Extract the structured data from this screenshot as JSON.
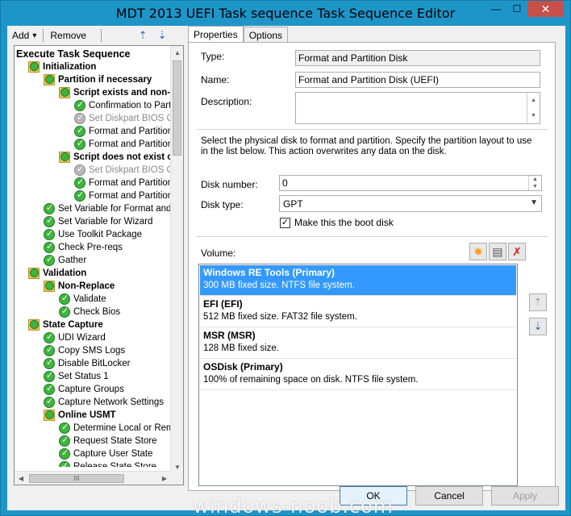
{
  "window": {
    "title": "MDT 2013 UEFI Task sequence Task Sequence Editor",
    "minimize": "—",
    "maximize": "☐",
    "close": "✕"
  },
  "toolbar": {
    "add_label": "Add",
    "add_arrow": "▾",
    "remove_label": "Remove",
    "move_up_icon": "⇡",
    "move_down_icon": "⇣"
  },
  "tree": {
    "nodes": [
      {
        "label": "Execute Task Sequence",
        "indent": 0,
        "icon": "none",
        "style": "group"
      },
      {
        "label": "Initialization",
        "indent": 1,
        "icon": "folder",
        "style": "bold"
      },
      {
        "label": "Partition if necessary",
        "indent": 2,
        "icon": "folder",
        "style": "bold"
      },
      {
        "label": "Script exists and non-N",
        "indent": 3,
        "icon": "folder",
        "style": "bold"
      },
      {
        "label": "Confirmation to Partition",
        "indent": 4,
        "icon": "check",
        "style": "normal"
      },
      {
        "label": "Set Diskpart BIOS Com",
        "indent": 4,
        "icon": "gcheck",
        "style": "grey"
      },
      {
        "label": "Format and Partition Dis",
        "indent": 4,
        "icon": "check",
        "style": "normal"
      },
      {
        "label": "Format and Partition Dis",
        "indent": 4,
        "icon": "check",
        "style": "normal"
      },
      {
        "label": "Script does not exist or",
        "indent": 3,
        "icon": "folder",
        "style": "bold"
      },
      {
        "label": "Set Diskpart BIOS Com",
        "indent": 4,
        "icon": "gcheck",
        "style": "grey"
      },
      {
        "label": "Format and Partition Dis",
        "indent": 4,
        "icon": "check",
        "style": "normal"
      },
      {
        "label": "Format and Partition Dis",
        "indent": 4,
        "icon": "check",
        "style": "normal"
      },
      {
        "label": "Set Variable for Format and Par",
        "indent": 2,
        "icon": "check",
        "style": "normal"
      },
      {
        "label": "Set Variable for Wizard",
        "indent": 2,
        "icon": "check",
        "style": "normal"
      },
      {
        "label": "Use Toolkit Package",
        "indent": 2,
        "icon": "check",
        "style": "normal"
      },
      {
        "label": "Check Pre-reqs",
        "indent": 2,
        "icon": "check",
        "style": "normal"
      },
      {
        "label": "Gather",
        "indent": 2,
        "icon": "check",
        "style": "normal"
      },
      {
        "label": "Validation",
        "indent": 1,
        "icon": "folder",
        "style": "bold"
      },
      {
        "label": "Non-Replace",
        "indent": 2,
        "icon": "folder",
        "style": "bold"
      },
      {
        "label": "Validate",
        "indent": 3,
        "icon": "check",
        "style": "normal"
      },
      {
        "label": "Check Bios",
        "indent": 3,
        "icon": "check",
        "style": "normal"
      },
      {
        "label": "State Capture",
        "indent": 1,
        "icon": "folder",
        "style": "bold"
      },
      {
        "label": "UDI Wizard",
        "indent": 2,
        "icon": "check",
        "style": "normal"
      },
      {
        "label": "Copy SMS Logs",
        "indent": 2,
        "icon": "check",
        "style": "normal"
      },
      {
        "label": "Disable BitLocker",
        "indent": 2,
        "icon": "check",
        "style": "normal"
      },
      {
        "label": "Set Status 1",
        "indent": 2,
        "icon": "check",
        "style": "normal"
      },
      {
        "label": "Capture Groups",
        "indent": 2,
        "icon": "check",
        "style": "normal"
      },
      {
        "label": "Capture Network Settings",
        "indent": 2,
        "icon": "check",
        "style": "normal"
      },
      {
        "label": "Online USMT",
        "indent": 2,
        "icon": "folder",
        "style": "bold"
      },
      {
        "label": "Determine Local or Remote",
        "indent": 3,
        "icon": "check",
        "style": "normal"
      },
      {
        "label": "Request State Store",
        "indent": 3,
        "icon": "check",
        "style": "normal"
      },
      {
        "label": "Capture User State",
        "indent": 3,
        "icon": "check",
        "style": "normal"
      },
      {
        "label": "Release State Store",
        "indent": 3,
        "icon": "check",
        "style": "normal"
      }
    ],
    "scroll_up": "▲",
    "scroll_down": "▼",
    "scroll_left": "◀",
    "scroll_right": "▶",
    "hthumb_grip": "III"
  },
  "tabs": [
    {
      "label": "Properties",
      "active": true
    },
    {
      "label": "Options",
      "active": false
    }
  ],
  "properties": {
    "type_label": "Type:",
    "type_value": "Format and Partition Disk",
    "name_label": "Name:",
    "name_value": "Format and Partition Disk (UEFI)",
    "description_label": "Description:",
    "description_value": "",
    "instructions": "Select the physical disk to format and partition. Specify the partition layout to use in the list below. This action overwrites any data on the disk.",
    "disk_number_label": "Disk number:",
    "disk_number_value": "0",
    "disk_type_label": "Disk type:",
    "disk_type_value": "GPT",
    "boot_disk_label": "Make this the boot disk",
    "boot_disk_checked": true,
    "volume_label": "Volume:"
  },
  "volumes": [
    {
      "name": "Windows RE Tools (Primary)",
      "info": "300 MB fixed size. NTFS file system.",
      "selected": true
    },
    {
      "name": "EFI (EFI)",
      "info": "512 MB fixed size. FAT32 file system.",
      "selected": false
    },
    {
      "name": "MSR (MSR)",
      "info": "128 MB fixed size.",
      "selected": false
    },
    {
      "name": "OSDisk (Primary)",
      "info": "100% of remaining space on disk. NTFS file system.",
      "selected": false
    }
  ],
  "icons": {
    "new_volume": "✸",
    "properties_volume": "▤",
    "delete_volume": "✗",
    "move_up": "⇡",
    "move_down": "⇣",
    "spin_up": "▲",
    "spin_down": "▼",
    "dropdown": "▼",
    "check": "✓"
  },
  "colors": {
    "selection": "#3399ff",
    "title_bar": "#1e95c9",
    "close_button": "#c7504b",
    "success_green": "#3fb43f",
    "delete_red": "#d02020",
    "new_yellow": "#f5a623"
  },
  "buttons": {
    "ok": "OK",
    "cancel": "Cancel",
    "apply": "Apply"
  },
  "watermark": "windows-noob.com"
}
